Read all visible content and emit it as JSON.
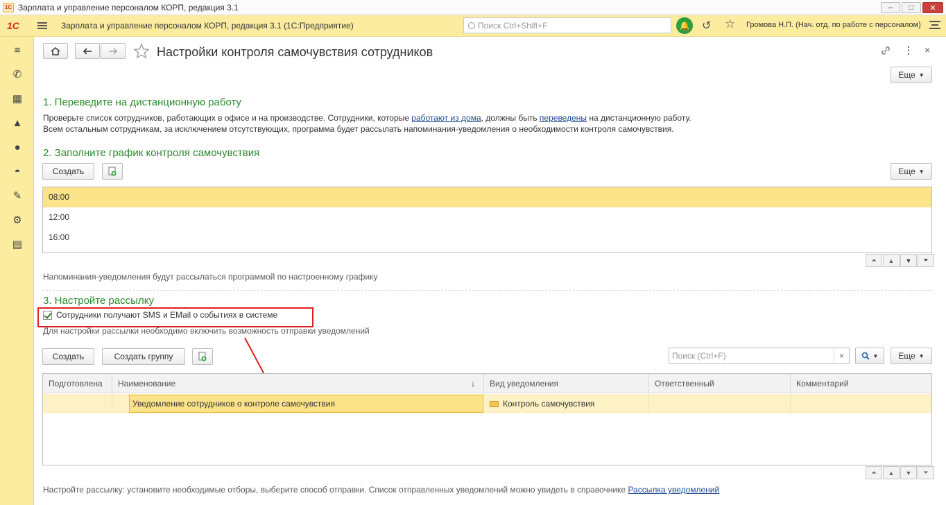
{
  "window": {
    "title": "Зарплата и управление персоналом КОРП, редакция 3.1",
    "controls": {
      "minimize": "–",
      "maximize": "□",
      "close": "✕"
    }
  },
  "appbar": {
    "logo": "1С",
    "title": "Зарплата и управление персоналом КОРП, редакция 3.1  (1С:Предприятие)",
    "search_placeholder": "Поиск Ctrl+Shift+F",
    "user": "Громова Н.П. (Нач. отд. по работе с персоналом)"
  },
  "sidebar": {
    "icons": [
      "menu-icon",
      "phone-icon",
      "gift-icon",
      "education-icon",
      "users-icon",
      "helmet-icon",
      "wrench-icon",
      "gear-icon",
      "id-card-icon"
    ]
  },
  "page": {
    "title": "Настройки контроля самочувствия сотрудников",
    "more_label": "Еще",
    "section1": {
      "heading": "1. Переведите на дистанционную работу",
      "text_a": "Проверьте список сотрудников, работающих в офисе и на производстве. Сотрудники, которые ",
      "link_a": "работают из дома",
      "text_b": ", должны быть ",
      "link_b": "переведены",
      "text_c": " на дистанционную работу.",
      "line2": "Всем остальным сотрудникам, за исключением отсутствующих, программа будет рассылать напоминания-уведомления о необходимости контроля самочувствия."
    },
    "section2": {
      "heading": "2. Заполните график контроля самочувствия",
      "create_label": "Создать",
      "more_label": "Еще",
      "rows": [
        "08:00",
        "12:00",
        "16:00"
      ],
      "note": "Напоминания-уведомления будут рассылаться программой по настроенному графику"
    },
    "section3": {
      "heading": "3. Настройте рассылку",
      "checkbox_label": "Сотрудники получают SMS и EMail о событиях в системе",
      "checkbox_checked": true,
      "hint": "Для настройки рассылки необходимо включить возможность отправки уведомлений",
      "create_label": "Создать",
      "create_group_label": "Создать группу",
      "search_placeholder": "Поиск (Ctrl+F)",
      "search_clear": "×",
      "more_label": "Еще",
      "columns": {
        "prepared": "Подготовлена",
        "name": "Наименование",
        "sort": "↓",
        "type": "Вид уведомления",
        "responsible": "Ответственный",
        "comment": "Комментарий"
      },
      "rows": [
        {
          "prepared": "",
          "name": "Уведомление сотрудников о контроле самочувствия",
          "type": "Контроль самочувствия",
          "responsible": "",
          "comment": ""
        }
      ],
      "footer_text": "Настройте рассылку: установите необходимые отборы, выберите способ отправки. Список отправленных уведомлений можно увидеть в справочнике ",
      "footer_link": "Рассылка уведомлений"
    }
  },
  "colors": {
    "accent_yellow": "#fbeca0",
    "section_green": "#2c8a2c",
    "highlight_red": "#e02020",
    "selected_row": "#fbe38a"
  }
}
